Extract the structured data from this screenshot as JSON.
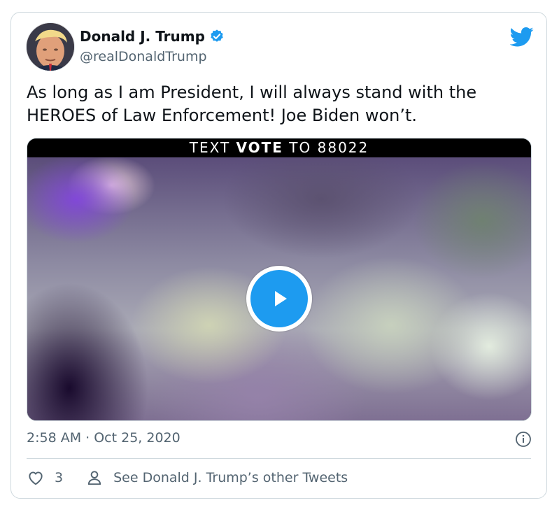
{
  "author": {
    "name": "Donald J. Trump",
    "handle": "@realDonaldTrump",
    "verified": true
  },
  "tweet": {
    "text": "As long as I am President, I will always stand with the HEROES of Law Enforcement! Joe Biden won’t.",
    "timestamp": "2:58 AM · Oct 25, 2020"
  },
  "media": {
    "banner_prefix": "TEXT ",
    "banner_bold": "VOTE",
    "banner_suffix": " TO 88022",
    "type": "video"
  },
  "actions": {
    "like_count": "3",
    "other_tweets_label": "See Donald J. Trump’s other Tweets"
  },
  "colors": {
    "accent": "#1d9bf0",
    "text": "#0f1419",
    "secondary": "#536471",
    "border": "#cfd9de"
  },
  "icons": {
    "logo": "twitter-bird-icon",
    "verified": "verified-badge-icon",
    "play": "play-icon",
    "info": "info-icon",
    "like": "heart-icon",
    "profile": "person-icon"
  }
}
